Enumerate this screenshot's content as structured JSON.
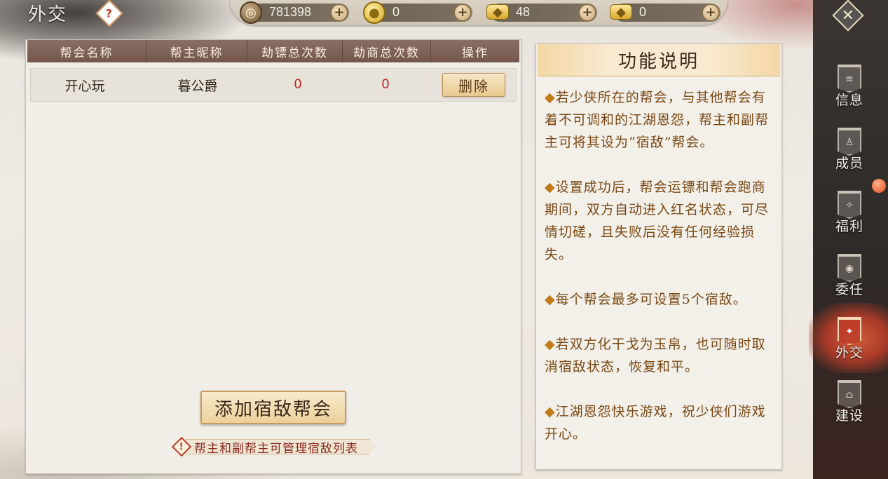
{
  "page": {
    "title": "外交",
    "help_symbol": "?"
  },
  "currencies": [
    {
      "name": "copper-coin",
      "value": "781398",
      "icon": "copper-coin-icon"
    },
    {
      "name": "gold-coin",
      "value": "0",
      "icon": "gold-coin-icon"
    },
    {
      "name": "gold-ingot-bound",
      "value": "48",
      "icon": "bound-ingot-icon"
    },
    {
      "name": "gold-ingot",
      "value": "0",
      "icon": "gold-ingot-icon"
    }
  ],
  "add_symbol": "+",
  "close_symbol": "✕",
  "sidenav": {
    "items": [
      {
        "label": "信息",
        "icon": "info-banner-icon"
      },
      {
        "label": "成员",
        "icon": "member-banner-icon"
      },
      {
        "label": "福利",
        "icon": "welfare-banner-icon"
      },
      {
        "label": "委任",
        "icon": "appoint-banner-icon"
      },
      {
        "label": "外交",
        "icon": "diplomacy-banner-icon",
        "active": true
      },
      {
        "label": "建设",
        "icon": "build-banner-icon"
      }
    ]
  },
  "table": {
    "headers": [
      "帮会名称",
      "帮主昵称",
      "劫镖总次数",
      "劫商总次数",
      "操作"
    ],
    "rows": [
      {
        "guild": "开心玩",
        "leader": "暮公爵",
        "escort_robbed": "0",
        "merchant_robbed": "0",
        "action": "删除"
      }
    ]
  },
  "add_button": "添加宿敌帮会",
  "tip": "帮主和副帮主可管理宿敌列表",
  "info": {
    "title": "功能说明",
    "paragraphs": [
      "若少侠所在的帮会，与其他帮会有着不可调和的江湖恩怨，帮主和副帮主可将其设为“宿敌”帮会。",
      "设置成功后，帮会运镖和帮会跑商期间，双方自动进入红名状态，可尽情切磋，且失败后没有任何经验损失。",
      "每个帮会最多可设置5个宿敌。",
      "若双方化干戈为玉帛，也可随时取消宿敌状态，恢复和平。",
      "江湖恩怨快乐游戏，祝少侠们游戏开心。"
    ],
    "bullet": "◆"
  },
  "colors": {
    "accent": "#c8191e",
    "header_brown": "#73574d",
    "info_text": "#7a4712"
  }
}
